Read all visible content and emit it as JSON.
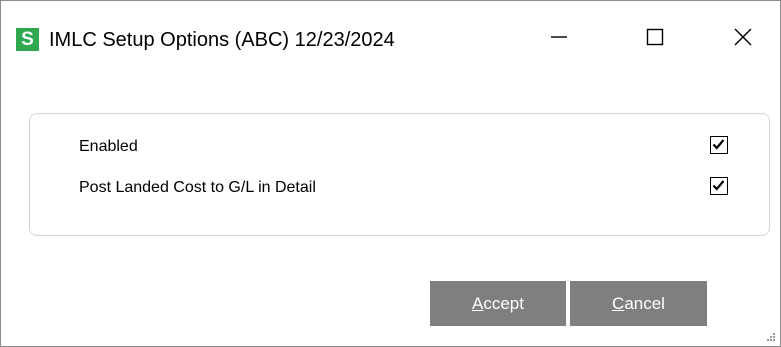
{
  "window": {
    "title": "IMLC Setup Options (ABC) 12/23/2024",
    "app_icon_letter": "S",
    "app_icon_color": "#2fa84f",
    "controls": {
      "minimize_icon": "minimize-icon",
      "maximize_icon": "maximize-icon",
      "close_icon": "close-icon"
    }
  },
  "options": [
    {
      "label": "Enabled",
      "checked": true
    },
    {
      "label": "Post Landed Cost to G/L in Detail",
      "checked": true
    }
  ],
  "buttons": {
    "accept": {
      "mnemonic": "A",
      "rest": "ccept"
    },
    "cancel": {
      "mnemonic": "C",
      "rest": "ancel"
    },
    "color": "#7f7f7f"
  }
}
